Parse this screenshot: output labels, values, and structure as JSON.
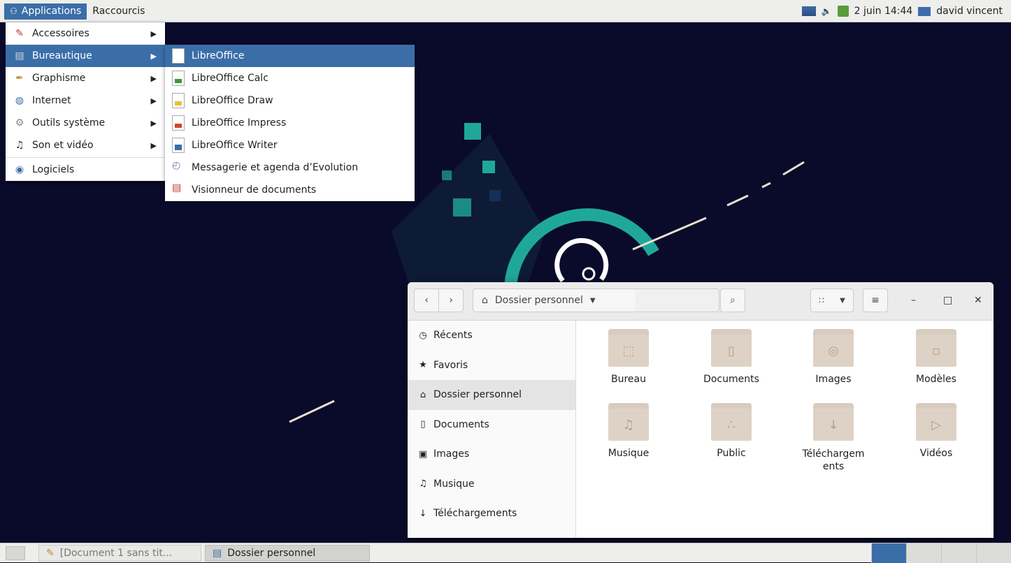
{
  "top_panel": {
    "applications_label": "Applications",
    "raccourcis_label": "Raccourcis",
    "datetime": "2 juin 14:44",
    "user": "david vincent"
  },
  "menu_main": {
    "items": [
      {
        "label": "Accessoires",
        "icon": "accessories-icon"
      },
      {
        "label": "Bureautique",
        "icon": "office-icon"
      },
      {
        "label": "Graphisme",
        "icon": "graphics-icon"
      },
      {
        "label": "Internet",
        "icon": "internet-icon"
      },
      {
        "label": "Outils système",
        "icon": "system-tools-icon"
      },
      {
        "label": "Son et vidéo",
        "icon": "multimedia-icon"
      },
      {
        "label": "Logiciels",
        "icon": "software-icon"
      }
    ]
  },
  "menu_sub": {
    "items": [
      {
        "label": "LibreOffice",
        "icon": "libreoffice-icon"
      },
      {
        "label": "LibreOffice Calc",
        "icon": "calc-icon"
      },
      {
        "label": "LibreOffice Draw",
        "icon": "draw-icon"
      },
      {
        "label": "LibreOffice Impress",
        "icon": "impress-icon"
      },
      {
        "label": "LibreOffice Writer",
        "icon": "writer-icon"
      },
      {
        "label": "Messagerie et agenda d’Evolution",
        "icon": "evolution-icon"
      },
      {
        "label": "Visionneur de documents",
        "icon": "document-viewer-icon"
      }
    ]
  },
  "file_manager": {
    "path_label": "Dossier personnel",
    "sidebar": [
      {
        "label": "Récents",
        "icon": "clock-icon"
      },
      {
        "label": "Favoris",
        "icon": "star-icon"
      },
      {
        "label": "Dossier personnel",
        "icon": "home-icon"
      },
      {
        "label": "Documents",
        "icon": "document-icon"
      },
      {
        "label": "Images",
        "icon": "camera-icon"
      },
      {
        "label": "Musique",
        "icon": "music-icon"
      },
      {
        "label": "Téléchargements",
        "icon": "download-icon"
      }
    ],
    "folders": [
      {
        "label": "Bureau",
        "icon": "desktop-folder-icon"
      },
      {
        "label": "Documents",
        "icon": "documents-folder-icon"
      },
      {
        "label": "Images",
        "icon": "pictures-folder-icon"
      },
      {
        "label": "Modèles",
        "icon": "templates-folder-icon"
      },
      {
        "label": "Musique",
        "icon": "music-folder-icon"
      },
      {
        "label": "Public",
        "icon": "public-folder-icon"
      },
      {
        "label": "Téléchargem\nents",
        "icon": "downloads-folder-icon"
      },
      {
        "label": "Vidéos",
        "icon": "videos-folder-icon"
      }
    ]
  },
  "taskbar": {
    "items": [
      {
        "label": "[Document 1 sans tit...",
        "icon": "writer-task-icon"
      },
      {
        "label": "Dossier personnel",
        "icon": "folder-task-icon"
      }
    ]
  },
  "colors": {
    "accent": "#3b6ea8",
    "desktop_bg": "#0a0a2b",
    "wallpaper_teal": "#1fa89a",
    "folder": "#ded2c6"
  }
}
